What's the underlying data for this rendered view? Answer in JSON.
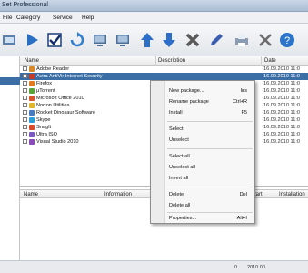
{
  "window": {
    "title": "Set Professional"
  },
  "menu": [
    "File",
    "Category",
    "Service",
    "Help"
  ],
  "toolbar": {
    "icons": [
      "refresh-icon",
      "play-icon",
      "checkbox-icon",
      "sync-icon",
      "monitor-icon",
      "monitor-icon",
      "arrow-up-icon",
      "arrow-down-icon",
      "delete-icon",
      "pencil-icon",
      "printer-icon",
      "tools-icon",
      "help-icon"
    ]
  },
  "grid": {
    "headers": [
      "Name",
      "Description",
      "Date"
    ],
    "rows": [
      {
        "name": "Adobe Reader",
        "date": "16.09.2010 11:0"
      },
      {
        "name": "Avira AntiVir Internet Security",
        "date": "16.09.2010 11:0",
        "selected": true
      },
      {
        "name": "Firefox",
        "date": "16.09.2010 11:0"
      },
      {
        "name": "µTorrent",
        "date": "16.09.2010 11:0"
      },
      {
        "name": "Microsoft Office 2010",
        "date": "16.09.2010 11:0"
      },
      {
        "name": "Norton Utilities",
        "date": "16.09.2010 11:0"
      },
      {
        "name": "Rocket Dinosaur Software",
        "date": "16.09.2010 11:0"
      },
      {
        "name": "Skype",
        "date": "16.09.2010 11:0"
      },
      {
        "name": "SnagIt",
        "date": "16.09.2010 11:0"
      },
      {
        "name": "Ultra ISO",
        "date": "16.09.2010 11:0"
      },
      {
        "name": "Visual Studio 2010",
        "date": "16.09.2010 11:0"
      }
    ]
  },
  "details_pane": {
    "headers": [
      "Name",
      "Information",
      "Start",
      "Installation"
    ]
  },
  "context_menu": {
    "items": [
      {
        "label": "New package...",
        "shortcut": "Ins"
      },
      {
        "label": "Rename package",
        "shortcut": "Ctrl+R"
      },
      {
        "label": "Install",
        "shortcut": "F5"
      },
      {
        "label": "Select",
        "shortcut": ""
      },
      {
        "label": "Unselect",
        "shortcut": ""
      },
      {
        "label": "Select all",
        "shortcut": ""
      },
      {
        "label": "Unselect all",
        "shortcut": ""
      },
      {
        "label": "Invert all",
        "shortcut": ""
      },
      {
        "label": "Delete",
        "shortcut": "Del"
      },
      {
        "label": "Delete all",
        "shortcut": ""
      },
      {
        "label": "Properties...",
        "shortcut": "Alt+I"
      }
    ]
  },
  "status": {
    "left": "0",
    "center": "2010.00"
  }
}
